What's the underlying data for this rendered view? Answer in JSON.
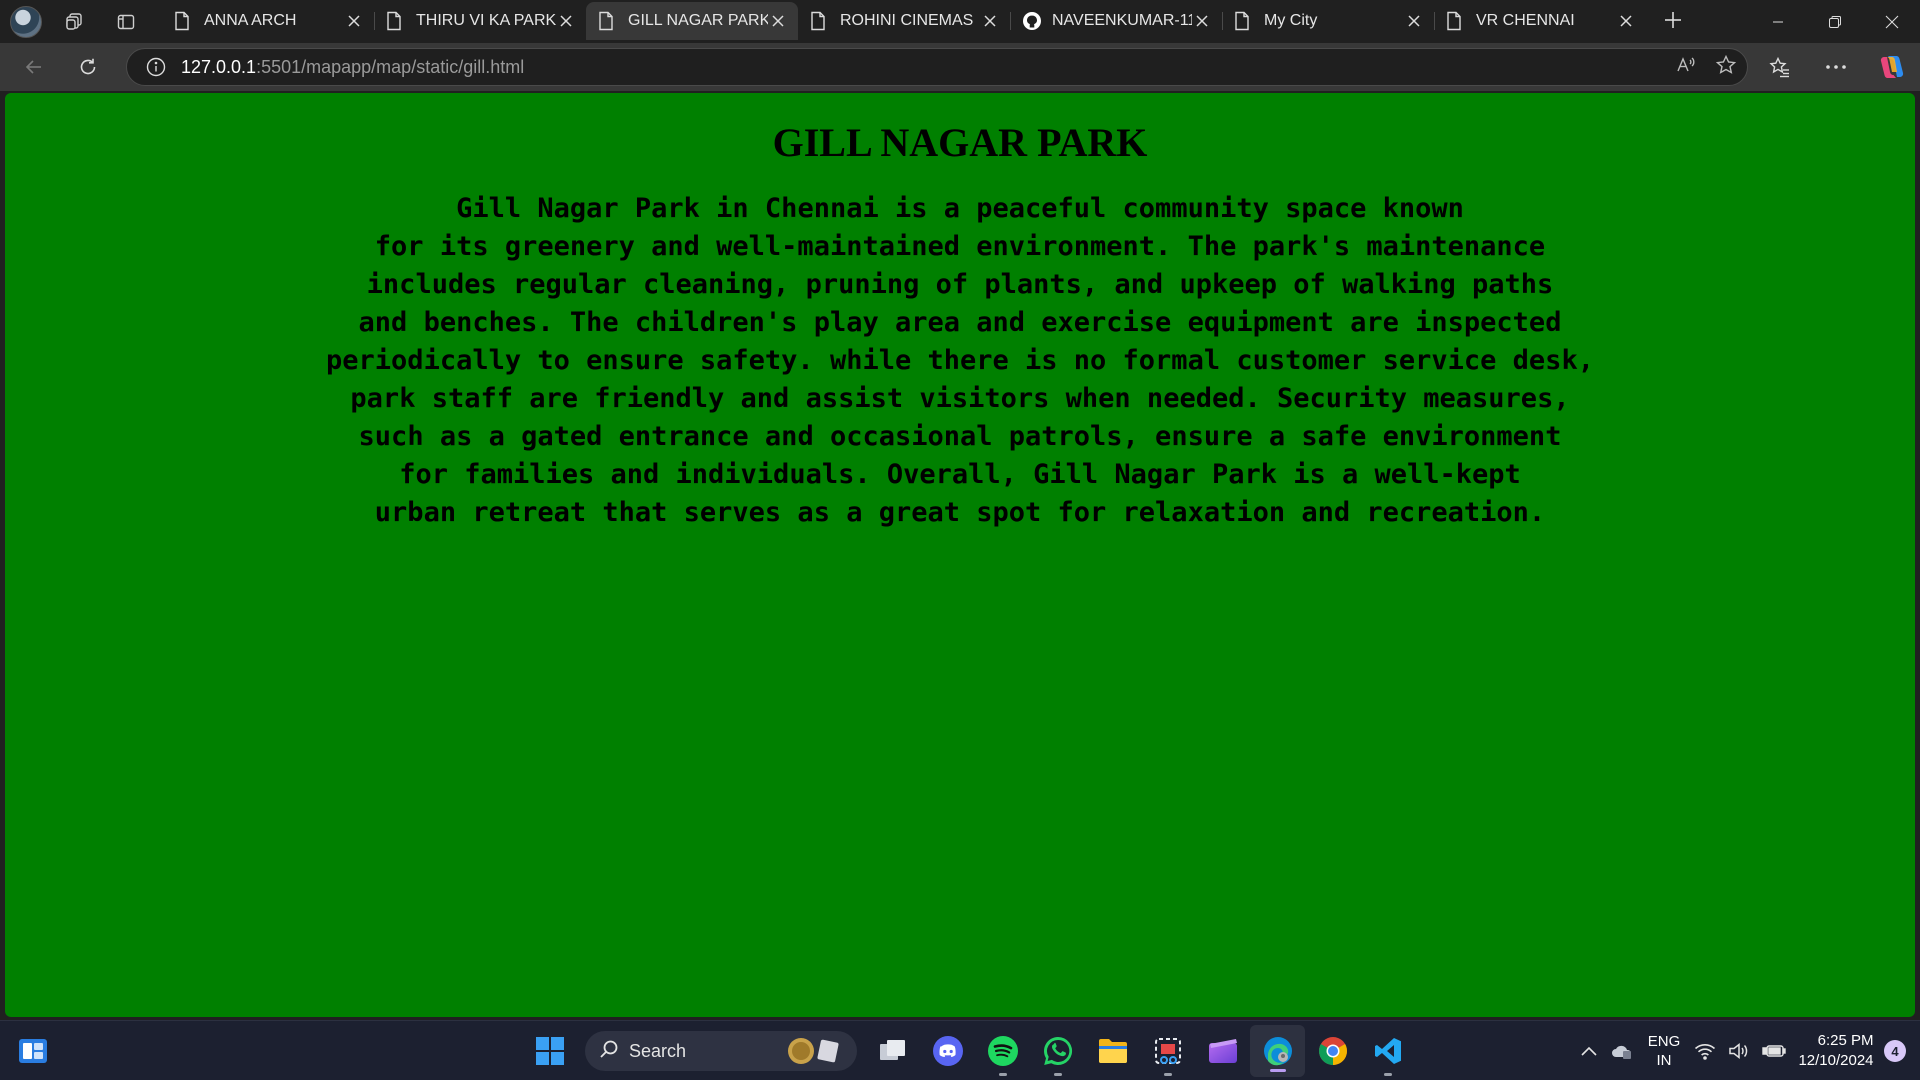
{
  "browser": {
    "tabs": [
      {
        "title": "ANNA ARCH",
        "icon": "page-icon",
        "active": false
      },
      {
        "title": "THIRU VI KA PARK",
        "icon": "page-icon",
        "active": false
      },
      {
        "title": "GILL NAGAR PARK",
        "icon": "page-icon",
        "active": true
      },
      {
        "title": "ROHINI CINEMAS",
        "icon": "page-icon",
        "active": false
      },
      {
        "title": "NAVEENKUMAR-11-",
        "icon": "github-icon",
        "active": false
      },
      {
        "title": "My City",
        "icon": "page-icon",
        "active": false
      },
      {
        "title": "VR CHENNAI",
        "icon": "page-icon",
        "active": false
      }
    ],
    "address": {
      "host": "127.0.0.1",
      "rest": ":5501/mapapp/map/static/gill.html"
    }
  },
  "page": {
    "background_color": "#008000",
    "title": "GILL NAGAR PARK",
    "paragraph_lines": [
      "Gill Nagar Park in Chennai is a peaceful community space known",
      "for its greenery and well-maintained environment. The park's maintenance",
      "includes regular cleaning, pruning of plants, and upkeep of walking paths",
      "and benches. The children's play area and exercise equipment are inspected",
      "periodically to ensure safety. while there is no formal customer service desk,",
      "park staff are friendly and assist visitors when needed. Security measures,",
      "such as a gated entrance and occasional patrols, ensure a safe environment",
      "for families and individuals. Overall, Gill Nagar Park is a well-kept",
      "urban retreat that serves as a great spot for relaxation and recreation."
    ]
  },
  "taskbar": {
    "search_label": "Search",
    "apps": [
      "task-view-icon",
      "discord-icon",
      "spotify-icon",
      "whatsapp-icon",
      "file-explorer-icon",
      "snipping-tool-icon",
      "clipchamp-icon",
      "edge-icon",
      "chrome-icon",
      "vscode-icon"
    ],
    "tray": {
      "lang_line1": "ENG",
      "lang_line2": "IN",
      "time": "6:25 PM",
      "date": "12/10/2024",
      "notification_count": "4"
    }
  }
}
